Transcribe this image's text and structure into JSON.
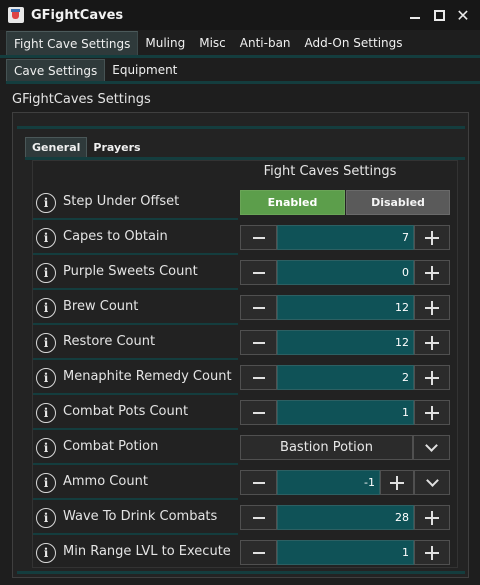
{
  "window": {
    "title": "GFightCaves"
  },
  "main_tabs": [
    "Fight Cave Settings",
    "Muling",
    "Misc",
    "Anti-ban",
    "Add-On Settings"
  ],
  "sub_tabs": [
    "Cave Settings",
    "Equipment"
  ],
  "section_title": "GFightCaves Settings",
  "inner_tabs": [
    "General",
    "Prayers"
  ],
  "form_header": "Fight Caves Settings",
  "info_glyph": "i",
  "rows": {
    "step_under": {
      "label": "Step Under Offset",
      "enabled": "Enabled",
      "disabled": "Disabled",
      "selected": "Enabled"
    },
    "capes": {
      "label": "Capes to Obtain",
      "value": "7"
    },
    "purple_sweets": {
      "label": "Purple Sweets Count",
      "value": "0"
    },
    "brew": {
      "label": "Brew Count",
      "value": "12"
    },
    "restore": {
      "label": "Restore Count",
      "value": "12"
    },
    "menaphite": {
      "label": "Menaphite Remedy Count",
      "value": "2"
    },
    "combat_pots": {
      "label": "Combat Pots Count",
      "value": "1"
    },
    "combat_potion": {
      "label": "Combat Potion",
      "value": "Bastion Potion"
    },
    "ammo": {
      "label": "Ammo Count",
      "value": "-1"
    },
    "wave_drink": {
      "label": "Wave To Drink Combats",
      "value": "28"
    },
    "min_range": {
      "label": "Min Range LVL to Execute",
      "value": "1"
    }
  },
  "icons": {
    "app": "app-icon",
    "minimize": "minimize-icon",
    "maximize": "maximize-icon",
    "close": "close-icon",
    "info": "info-icon",
    "minus": "minus-icon",
    "plus": "plus-icon",
    "dropdown": "chevron-down-icon"
  },
  "colors": {
    "accent_teal": "#143d3e",
    "value_field": "#0f5257",
    "enabled_green": "#5c9e4b",
    "disabled_gray": "#5a5a5a",
    "background": "#1e1e1e"
  }
}
